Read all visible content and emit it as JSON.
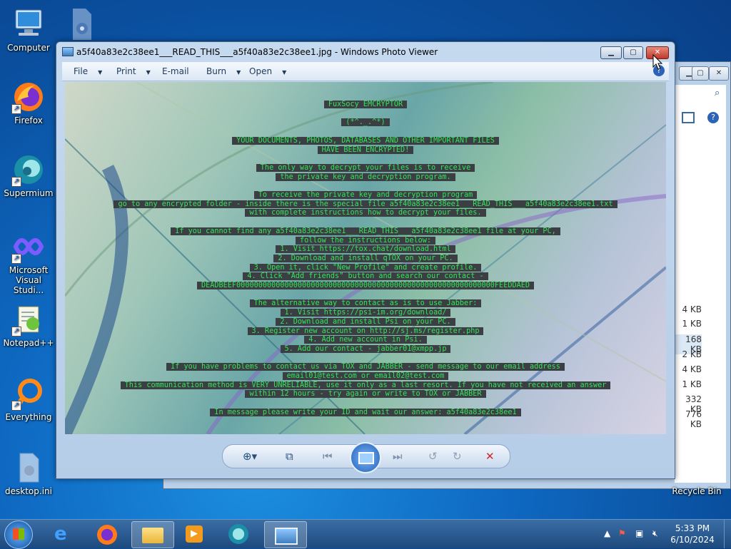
{
  "desktop": {
    "icons": [
      {
        "label": "Computer",
        "icon": "computer-icon"
      },
      {
        "label": "",
        "icon": "settings-file-icon"
      },
      {
        "label": "Firefox",
        "icon": "firefox-icon"
      },
      {
        "label": "Supermium",
        "icon": "supermium-icon"
      },
      {
        "label": "Microsoft Visual Studi...",
        "icon": "visual-studio-icon"
      },
      {
        "label": "Notepad++",
        "icon": "notepadpp-icon"
      },
      {
        "label": "Everything",
        "icon": "everything-icon"
      },
      {
        "label": "desktop.ini",
        "icon": "ini-file-icon"
      },
      {
        "label": "Recycle Bin",
        "icon": "recycle-bin-icon"
      }
    ]
  },
  "background_window": {
    "sizes": [
      "4 KB",
      "1 KB",
      "168 KB",
      "2 KB",
      "4 KB",
      "1 KB",
      "332 KB",
      "776 KB"
    ]
  },
  "viewer": {
    "title": "a5f40a83e2c38ee1___READ_THIS___a5f40a83e2c38ee1.jpg - Windows Photo Viewer",
    "menu": [
      {
        "label": "File",
        "has_arrow": true
      },
      {
        "label": "Print",
        "has_arrow": true
      },
      {
        "label": "E-mail",
        "has_arrow": false
      },
      {
        "label": "Burn",
        "has_arrow": true
      },
      {
        "label": "Open",
        "has_arrow": true
      }
    ],
    "note_lines": [
      "FuxSocy EMCRYPTOR",
      "",
      "(*^._.^*)",
      "",
      "YOUR DOCUMENTS, PHOTOS, DATABASES AND OTHER IMPORTANT FILES",
      "HAVE BEEN ENCRYPTED!",
      "",
      "The only way to decrypt your files is to receive",
      "the private key and decryption program.",
      "",
      "To receive the private key and decryption program",
      "go to any encrypted folder - inside there is the special file a5f40a83e2c38ee1___READ_THIS___a5f40a83e2c38ee1.txt",
      "with complete instructions how to decrypt your files.",
      "",
      "If you cannot find any a5f40a83e2c38ee1___READ_THIS___a5f40a83e2c38ee1 file at your PC,",
      "follow the instructions below:",
      "1. Visit https://tox.chat/download.html",
      "2. Download and install qTOX on your PC.",
      "3. Open it, click \"New Profile\" and create profile.",
      "4. Click \"Add friends\" button and search our contact -",
      "DEADBEEF00000000000000000000000000000000000000000000000000000000000FEEDDAED",
      "",
      "The alternative way to contact as is to use Jabber:",
      "1. Visit https://psi-im.org/download/",
      "2. Download and install Psi on your PC.",
      "3. Register new account on http://sj.ms/register.php",
      "4. Add new account in Psi.",
      "5. Add our contact - jabber01@xmpp.jp",
      "",
      "If you have problems to contact us via TOX and JABBER - send message to our email address",
      "email01@test.com or email02@test.com",
      "This communication method is VERY UNRELIABLE, use it only as a last resort. If you have not received an answer",
      "within 12 hours - try again or write to TOX or JABBER",
      "",
      "In message please write your ID and wait our answer: a5f40a83e2c38ee1"
    ]
  },
  "taskbar": {
    "clock_time": "5:33 PM",
    "clock_date": "6/10/2024"
  }
}
